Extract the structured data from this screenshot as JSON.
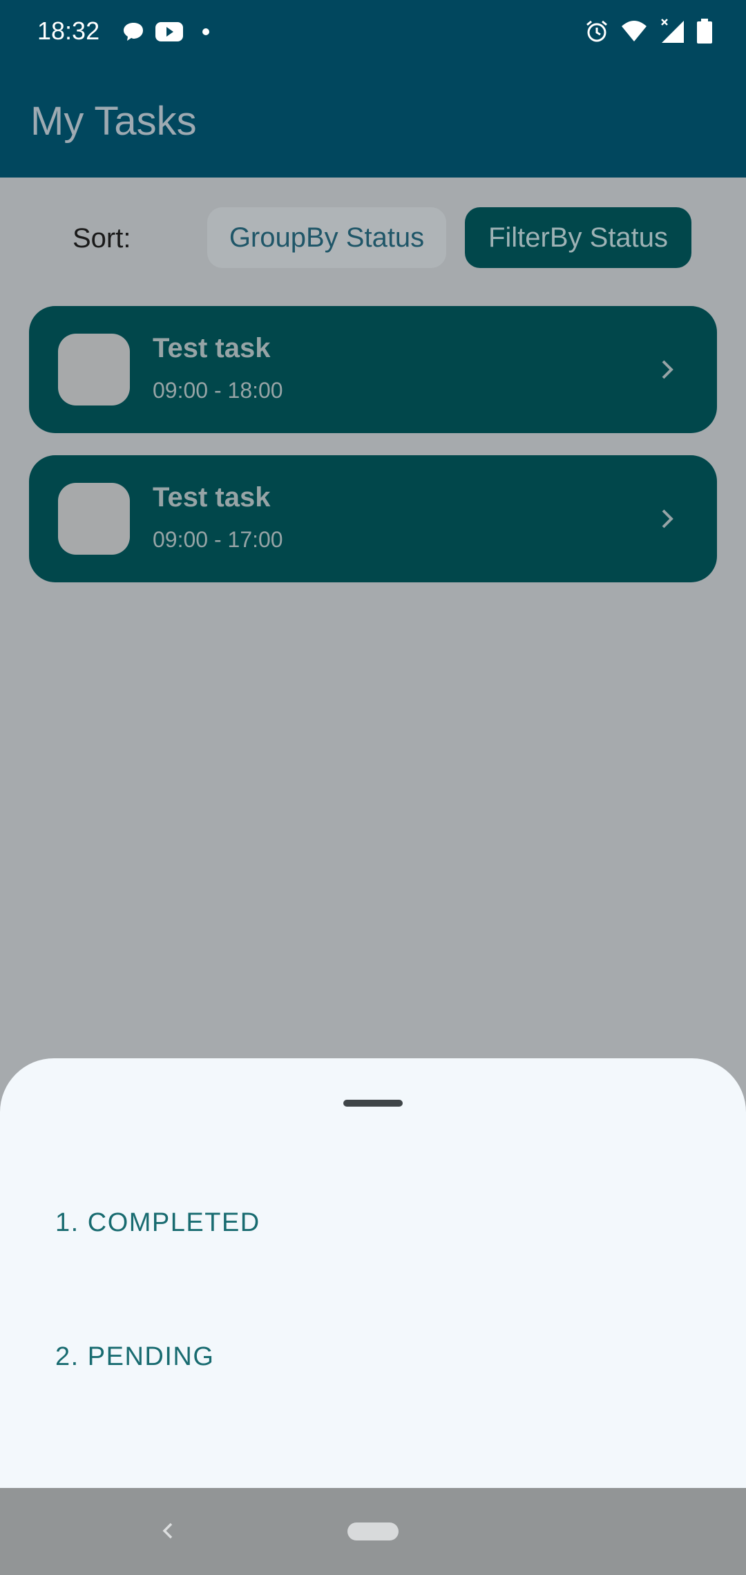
{
  "status_bar": {
    "time": "18:32",
    "left_icons": [
      "chat-bubble-icon",
      "youtube-icon",
      "dot-icon"
    ],
    "right_icons": [
      "alarm-icon",
      "wifi-icon",
      "signal-icon",
      "battery-icon"
    ]
  },
  "app_bar": {
    "title": "My Tasks"
  },
  "sort": {
    "label": "Sort:",
    "group_by_label": "GroupBy Status",
    "filter_by_label": "FilterBy Status"
  },
  "tasks": [
    {
      "title": "Test task",
      "time": "09:00 - 18:00"
    },
    {
      "title": "Test task",
      "time": "09:00 - 17:00"
    }
  ],
  "bottom_sheet": {
    "options": [
      "1. COMPLETED",
      "2. PENDING"
    ]
  },
  "colors": {
    "primary": "#01475e",
    "card": "#01474b",
    "accent_text": "#186b70",
    "sheet_bg": "#f3f8fc",
    "scrim": "#a6aaad"
  }
}
